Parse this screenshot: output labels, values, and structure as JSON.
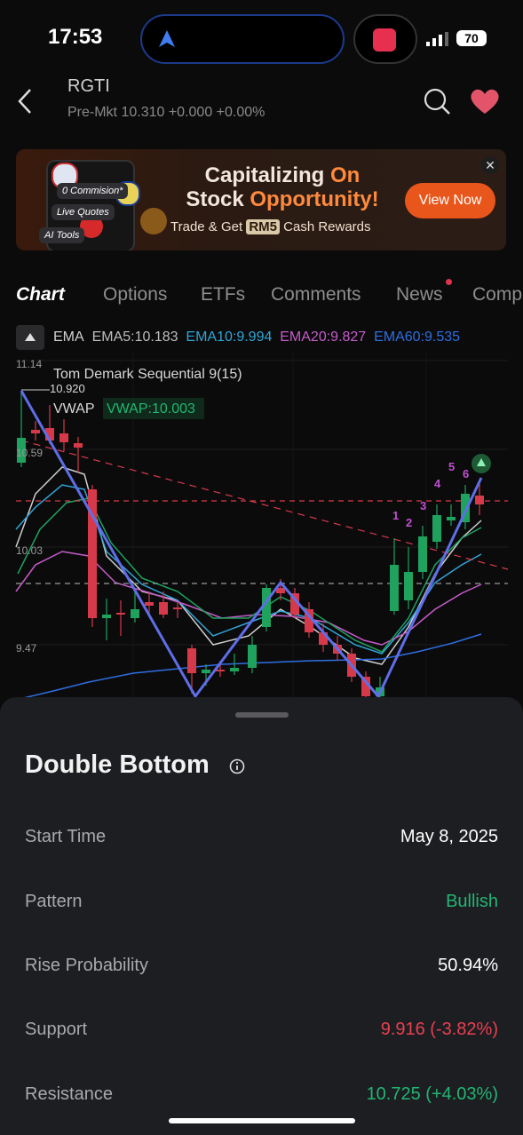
{
  "status": {
    "time": "17:53",
    "battery": "70"
  },
  "header": {
    "ticker": "RGTI",
    "premarket": "Pre-Mkt  10.310  +0.000  +0.00%"
  },
  "banner": {
    "pill1": "0 Commision*",
    "pill2": "Live Quotes",
    "pill3": "AI Tools",
    "title_part1": "Capitalizing ",
    "title_part2": "On",
    "title_line2a": "Stock ",
    "title_line2b": "Opportunity!",
    "sub_before": "Trade & Get ",
    "sub_badge": "RM5",
    "sub_after": " Cash Rewards",
    "button": "View Now",
    "close": "✕"
  },
  "tabs": [
    "Chart",
    "Options",
    "ETFs",
    "Comments",
    "News",
    "Comp"
  ],
  "chart": {
    "ema_label": "EMA",
    "ema5": "EMA5:10.183",
    "ema10": "EMA10:9.994",
    "ema20": "EMA20:9.827",
    "ema60": "EMA60:9.535",
    "td_label": "Tom Demark Sequential 9(15)",
    "vwap_label": "VWAP",
    "vwap_value": "VWAP:10.003",
    "high_label": "10.920",
    "y_ticks": [
      "11.14",
      "10.59",
      "10.03",
      "9.47"
    ],
    "td_counts": [
      "1",
      "2",
      "3",
      "4",
      "5",
      "6"
    ],
    "colors": {
      "up": "#1fa25e",
      "down": "#d63a4a",
      "ema5": "#cfcfcf",
      "ema10": "#32a5d6",
      "ema20": "#c55cc9",
      "ema60": "#2f6ee0",
      "pattern": "#5f6ee8"
    }
  },
  "sheet": {
    "title": "Double Bottom",
    "rows": [
      {
        "label": "Start Time",
        "value": "May 8, 2025",
        "color": "#ffffff"
      },
      {
        "label": "Pattern",
        "value": "Bullish",
        "color": "#22b573"
      },
      {
        "label": "Rise Probability",
        "value": "50.94%",
        "color": "#ffffff"
      },
      {
        "label": "Support",
        "value": "9.916 (-3.82%)",
        "color": "#e8404f"
      },
      {
        "label": "Resistance",
        "value": "10.725 (+4.03%)",
        "color": "#22b573"
      }
    ]
  }
}
